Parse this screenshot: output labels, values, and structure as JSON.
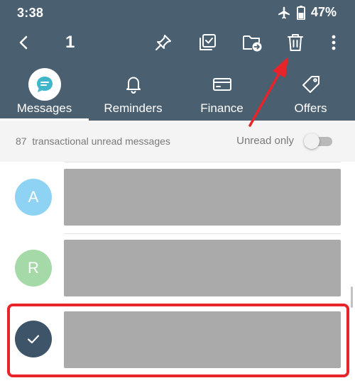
{
  "status_bar": {
    "time": "3:38",
    "battery_percent": "47%",
    "icons": [
      "airplane-icon",
      "battery-icon"
    ]
  },
  "action_bar": {
    "back_icon": "back-arrow-icon",
    "selected_count": "1",
    "actions": [
      "pin-icon",
      "select-all-icon",
      "move-to-folder-icon",
      "delete-icon",
      "more-options-icon"
    ]
  },
  "tabs": [
    {
      "label": "Messages",
      "icon": "chat-bubble-icon",
      "active": true
    },
    {
      "label": "Reminders",
      "icon": "bell-icon",
      "active": false
    },
    {
      "label": "Finance",
      "icon": "card-icon",
      "active": false
    },
    {
      "label": "Offers",
      "icon": "tag-icon",
      "active": false
    }
  ],
  "filter": {
    "count": "87",
    "description": "transactional unread messages",
    "unread_only_label": "Unread only",
    "unread_only_on": false
  },
  "messages": [
    {
      "avatar_letter": "A",
      "avatar_color": "#8fd3f4",
      "selected": false
    },
    {
      "avatar_letter": "R",
      "avatar_color": "#a6d9a8",
      "selected": false
    },
    {
      "avatar_letter": "",
      "avatar_color": "#3e5468",
      "selected": true,
      "avatar_icon": "checkmark-icon"
    }
  ],
  "colors": {
    "header": "#4a5f70",
    "annotation": "#e8232a",
    "redacted_block": "#aaaaaa"
  }
}
